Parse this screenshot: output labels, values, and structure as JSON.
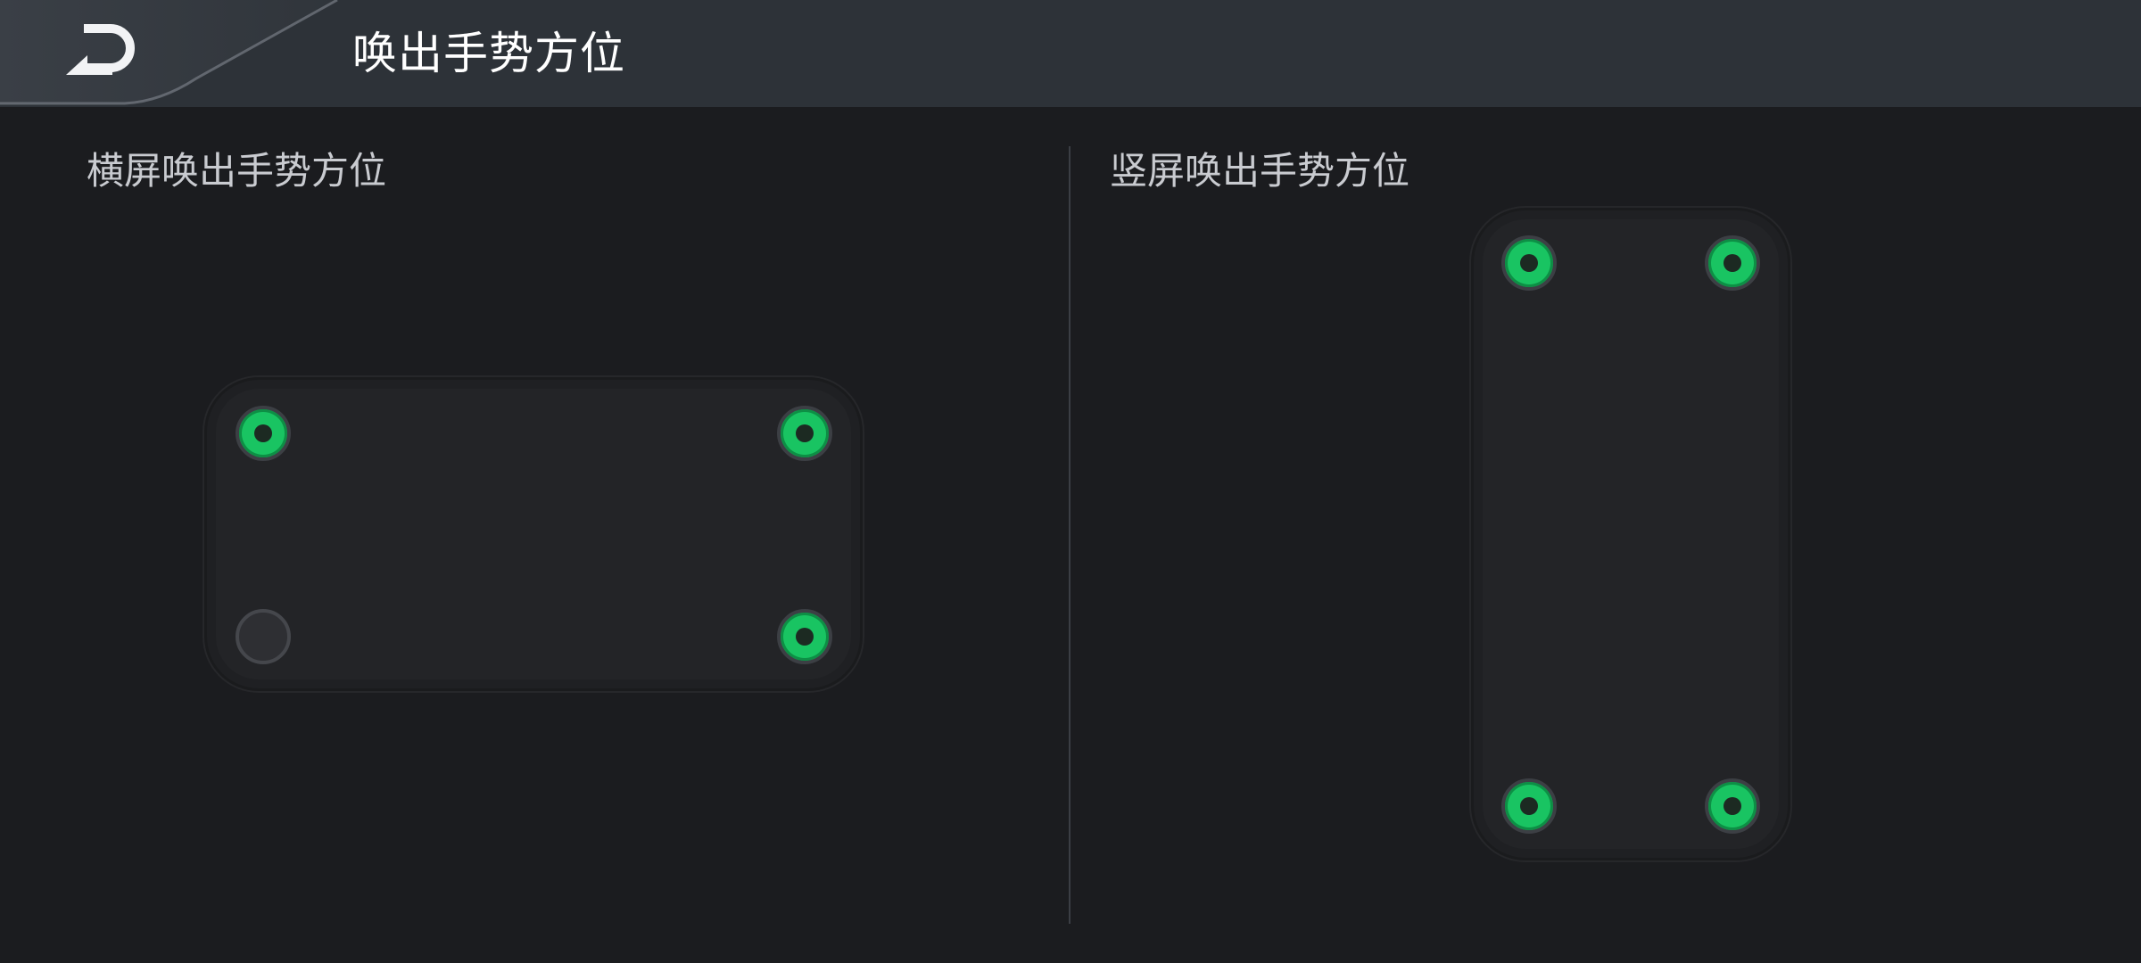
{
  "header": {
    "title": "唤出手势方位",
    "back_icon": "back-arrow-icon"
  },
  "landscape": {
    "title": "横屏唤出手势方位",
    "positions": [
      {
        "name": "top-left",
        "enabled": true
      },
      {
        "name": "top-right",
        "enabled": true
      },
      {
        "name": "bottom-left",
        "enabled": false
      },
      {
        "name": "bottom-right",
        "enabled": true
      }
    ]
  },
  "portrait": {
    "title": "竖屏唤出手势方位",
    "positions": [
      {
        "name": "top-left",
        "enabled": true
      },
      {
        "name": "top-right",
        "enabled": true
      },
      {
        "name": "bottom-left",
        "enabled": true
      },
      {
        "name": "bottom-right",
        "enabled": true
      }
    ]
  },
  "colors": {
    "background": "#1b1c1f",
    "header": "#2d3238",
    "accent_on": "#19c462",
    "off": "#2e2f33"
  }
}
